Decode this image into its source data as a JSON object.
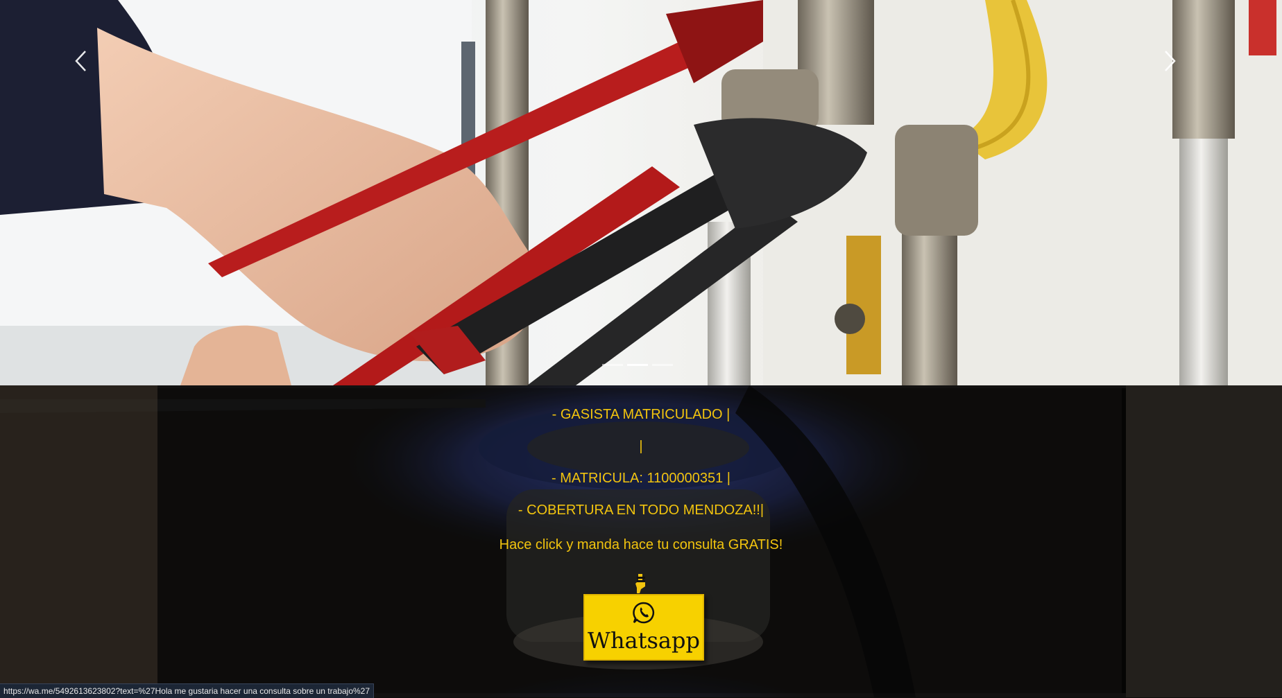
{
  "carousel": {
    "prev_icon": "chevron-left-icon",
    "next_icon": "chevron-right-icon",
    "slides": 3,
    "active_slide": 2,
    "image_subject": "hands with pliers on gas pipes"
  },
  "info": {
    "line1": "- GASISTA MATRICULADO |",
    "line2": "|",
    "line3": "- MATRICULA: 1100000351 |",
    "line4": "- COBERTURA EN TODO MENDOZA!!|",
    "line5": "Hace click y manda hace tu consulta GRATIS!",
    "text_color": "#f2c40e"
  },
  "whatsapp_button": {
    "label": "Whatsapp",
    "icon": "whatsapp-icon",
    "bg_color": "#f7d100"
  },
  "status_bar": {
    "url": "https://wa.me/5492613623802?text=%27Hola me gustaria hacer una consulta sobre un trabajo%27"
  }
}
